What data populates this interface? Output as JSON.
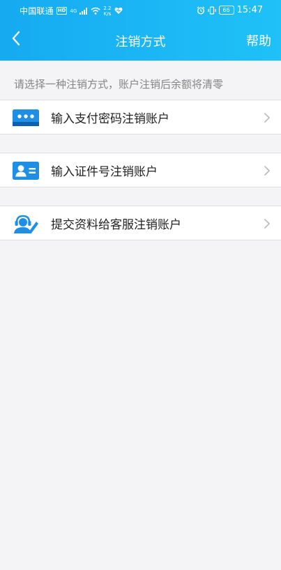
{
  "status_bar": {
    "carrier": "中国联通",
    "hd_badge": "HD",
    "network_type": "4G",
    "speed_value": "2.2",
    "speed_unit": "K/s",
    "signal_icon": "signal-bars-icon",
    "wifi_icon": "wifi-icon",
    "heart_icon": "heart-icon",
    "alarm_icon": "alarm-icon",
    "vibrate_icon": "vibrate-icon",
    "battery": "66",
    "time": "15:47"
  },
  "nav": {
    "back_icon": "chevron-left-icon",
    "title": "注销方式",
    "help_label": "帮助"
  },
  "hint": "请选择一种注销方式，账户注销后余额将清零",
  "options": [
    {
      "label": "输入支付密码注销账户",
      "icon": "password-dots-icon"
    },
    {
      "label": "输入证件号注销账户",
      "icon": "id-card-icon"
    },
    {
      "label": "提交资料给客服注销账户",
      "icon": "customer-service-icon"
    }
  ],
  "colors": {
    "header_start": "#16aaf0",
    "header_end": "#1fc1f7",
    "icon_blue": "#1f8fe6",
    "background": "#f4f4f6",
    "hint_text": "#858585"
  }
}
